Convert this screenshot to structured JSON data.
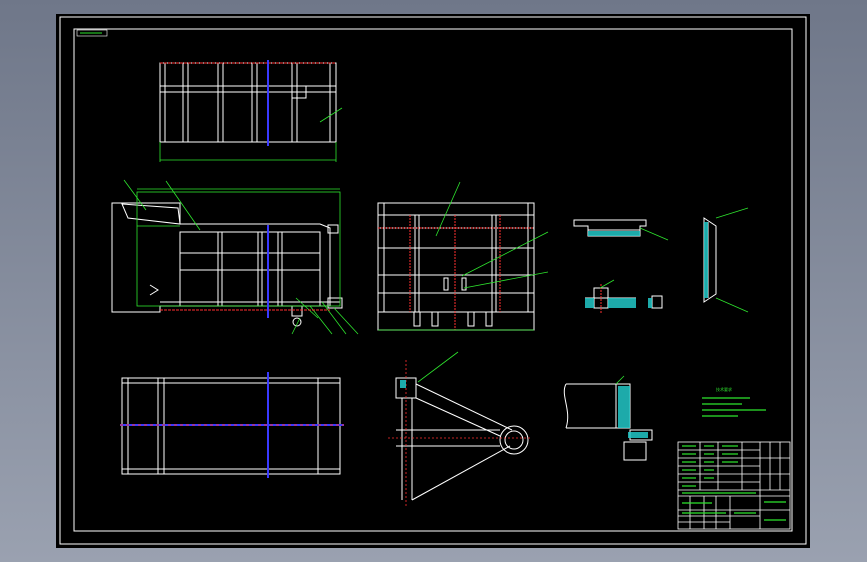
{
  "viewer": {
    "background": "#7f8797",
    "sheet_color": "#000000"
  },
  "colors": {
    "white_line": "#ffffff",
    "green_line": "#2ee62e",
    "red_line": "#ff3030",
    "blue_line": "#3a3aff",
    "cyan_hatch": "#22c8c8"
  },
  "drawing": {
    "corner_label": "",
    "tech_requirements_title": "技术要求",
    "tech_notes": [
      "",
      "",
      "",
      ""
    ],
    "title_block": {
      "drawing_name": "",
      "sub_label": ""
    }
  }
}
